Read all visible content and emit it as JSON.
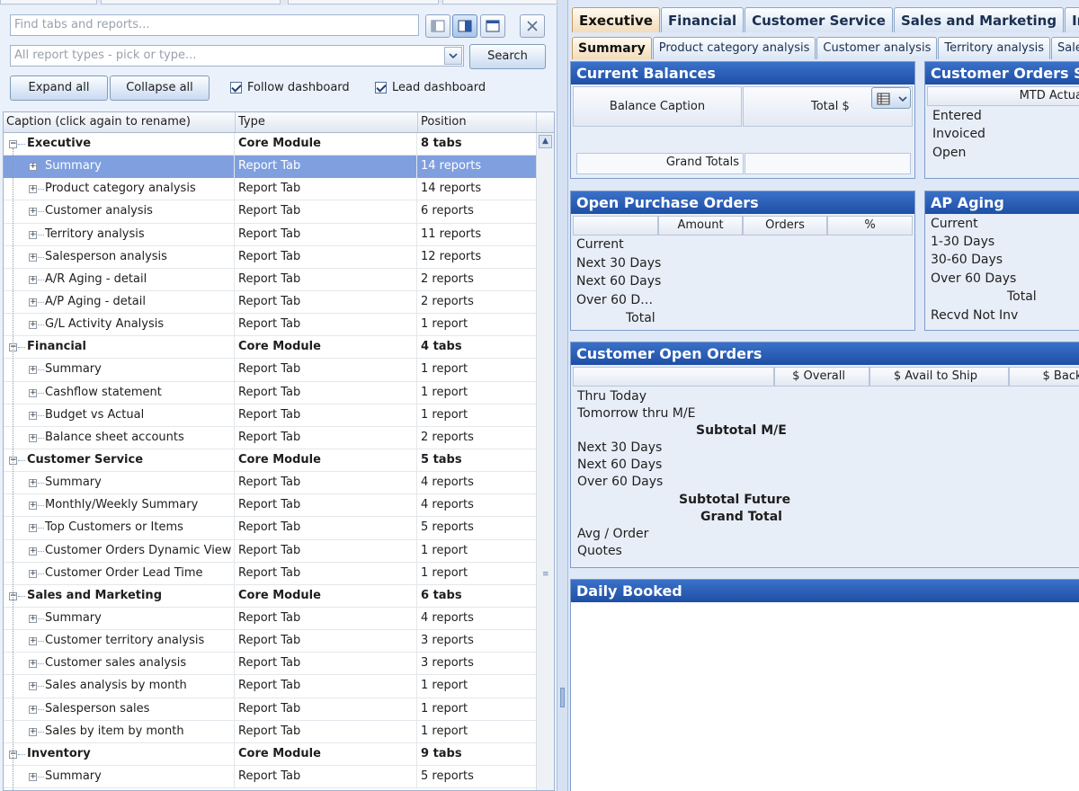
{
  "left": {
    "find_placeholder": "Find tabs and reports...",
    "report_types_placeholder": "All report types - pick or type...",
    "search_label": "Search",
    "expand_all_label": "Expand all",
    "collapse_all_label": "Collapse all",
    "follow_dashboard_label": "Follow dashboard",
    "lead_dashboard_label": "Lead dashboard",
    "columns": [
      "Caption  (click again to rename)",
      "Type",
      "Position"
    ],
    "rows": [
      {
        "level": 0,
        "caption": "Executive",
        "type": "Core Module",
        "position": "8 tabs"
      },
      {
        "level": 1,
        "caption": "Summary",
        "type": "Report Tab",
        "position": "14 reports",
        "selected": true
      },
      {
        "level": 1,
        "caption": "Product category analysis",
        "type": "Report Tab",
        "position": "14 reports"
      },
      {
        "level": 1,
        "caption": "Customer analysis",
        "type": "Report Tab",
        "position": "6 reports"
      },
      {
        "level": 1,
        "caption": "Territory analysis",
        "type": "Report Tab",
        "position": "11 reports"
      },
      {
        "level": 1,
        "caption": "Salesperson analysis",
        "type": "Report Tab",
        "position": "12 reports"
      },
      {
        "level": 1,
        "caption": "A/R Aging - detail",
        "type": "Report Tab",
        "position": "2 reports"
      },
      {
        "level": 1,
        "caption": "A/P Aging - detail",
        "type": "Report Tab",
        "position": "2 reports"
      },
      {
        "level": 1,
        "caption": "G/L Activity Analysis",
        "type": "Report Tab",
        "position": "1 report"
      },
      {
        "level": 0,
        "caption": "Financial",
        "type": "Core Module",
        "position": "4 tabs"
      },
      {
        "level": 1,
        "caption": "Summary",
        "type": "Report Tab",
        "position": "1 report"
      },
      {
        "level": 1,
        "caption": "Cashflow statement",
        "type": "Report Tab",
        "position": "1 report"
      },
      {
        "level": 1,
        "caption": "Budget vs Actual",
        "type": "Report Tab",
        "position": "1 report"
      },
      {
        "level": 1,
        "caption": "Balance sheet accounts",
        "type": "Report Tab",
        "position": "2 reports"
      },
      {
        "level": 0,
        "caption": "Customer Service",
        "type": "Core Module",
        "position": "5 tabs"
      },
      {
        "level": 1,
        "caption": "Summary",
        "type": "Report Tab",
        "position": "4 reports"
      },
      {
        "level": 1,
        "caption": "Monthly/Weekly Summary",
        "type": "Report Tab",
        "position": "4 reports"
      },
      {
        "level": 1,
        "caption": "Top Customers or Items",
        "type": "Report Tab",
        "position": "5 reports"
      },
      {
        "level": 1,
        "caption": "Customer Orders Dynamic View",
        "type": "Report Tab",
        "position": "1 report"
      },
      {
        "level": 1,
        "caption": "Customer Order Lead Time",
        "type": "Report Tab",
        "position": "1 report"
      },
      {
        "level": 0,
        "caption": "Sales and Marketing",
        "type": "Core Module",
        "position": "6 tabs"
      },
      {
        "level": 1,
        "caption": "Summary",
        "type": "Report Tab",
        "position": "4 reports"
      },
      {
        "level": 1,
        "caption": "Customer territory analysis",
        "type": "Report Tab",
        "position": "3 reports"
      },
      {
        "level": 1,
        "caption": "Customer sales analysis",
        "type": "Report Tab",
        "position": "3 reports"
      },
      {
        "level": 1,
        "caption": "Sales analysis by month",
        "type": "Report Tab",
        "position": "1 report"
      },
      {
        "level": 1,
        "caption": "Salesperson sales",
        "type": "Report Tab",
        "position": "1 report"
      },
      {
        "level": 1,
        "caption": "Sales by item by month",
        "type": "Report Tab",
        "position": "1 report"
      },
      {
        "level": 0,
        "caption": "Inventory",
        "type": "Core Module",
        "position": "9 tabs"
      },
      {
        "level": 1,
        "caption": "Summary",
        "type": "Report Tab",
        "position": "5 reports"
      }
    ]
  },
  "right": {
    "module_tabs": [
      "Executive",
      "Financial",
      "Customer Service",
      "Sales and Marketing",
      "Invento"
    ],
    "report_tabs": [
      "Summary",
      "Product category analysis",
      "Customer analysis",
      "Territory analysis",
      "Salesperso"
    ],
    "current_balances": {
      "title": "Current Balances",
      "col_caption": "Balance Caption",
      "col_total": "Total $",
      "grand_totals": "Grand Totals"
    },
    "customer_orders_summary": {
      "title": "Customer Orders Su",
      "col_mtd": "MTD Actua",
      "rows": [
        "Entered",
        "Invoiced",
        "Open"
      ]
    },
    "open_purchase_orders": {
      "title": "Open Purchase Orders",
      "columns": [
        "Amount",
        "Orders",
        "%"
      ],
      "rows": [
        "Current",
        "Next 30 Days",
        "Next 60 Days",
        "Over 60 D…"
      ],
      "total": "Total"
    },
    "ap_aging": {
      "title": "AP Aging",
      "rows": [
        "Current",
        "1-30 Days",
        "30-60 Days",
        "Over 60 Days"
      ],
      "total": "Total",
      "recvd": "Recvd Not Inv"
    },
    "customer_open_orders": {
      "title": "Customer Open Orders",
      "columns": [
        "$ Overall",
        "$ Avail to Ship",
        "$ Backo"
      ],
      "rows": [
        "Thru Today",
        "Tomorrow thru M/E"
      ],
      "subtotal_me": "Subtotal M/E",
      "rows2": [
        "Next 30 Days",
        "Next 60 Days",
        "Over 60 Days"
      ],
      "subtotal_future": "Subtotal Future",
      "grand_total": "Grand Total",
      "rows3": [
        "Avg / Order",
        "Quotes"
      ]
    },
    "daily_booked": {
      "title": "Daily Booked"
    }
  }
}
